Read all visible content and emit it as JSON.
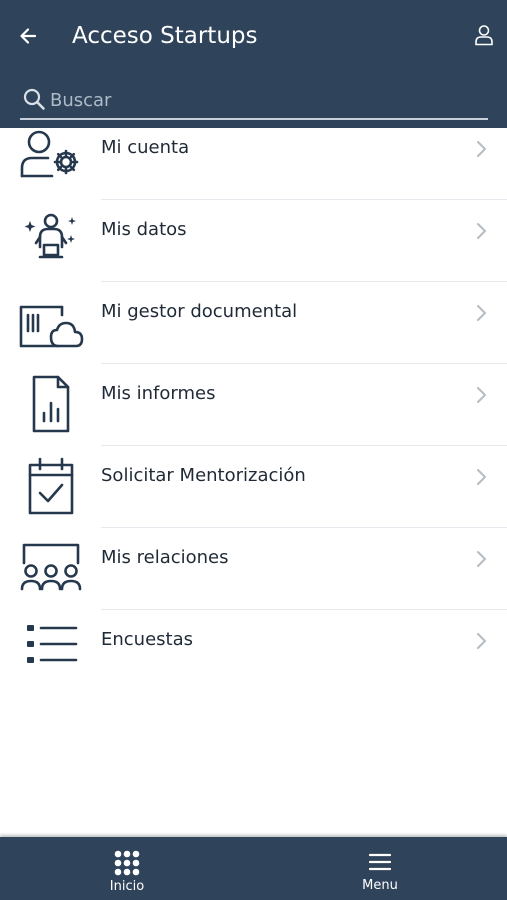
{
  "header": {
    "title": "Acceso Startups",
    "back_icon": "arrow-left-icon",
    "user_icon": "user-icon",
    "background": "#2f435a"
  },
  "search": {
    "placeholder": "Buscar",
    "value": "",
    "icon": "search-icon"
  },
  "menu": {
    "items": [
      {
        "label": "Mi cuenta",
        "icon": "user-settings-icon"
      },
      {
        "label": "Mis datos",
        "icon": "person-data-icon"
      },
      {
        "label": "Mi gestor documental",
        "icon": "document-cloud-icon"
      },
      {
        "label": "Mis informes",
        "icon": "report-icon"
      },
      {
        "label": "Solicitar Mentorización",
        "icon": "calendar-check-icon"
      },
      {
        "label": "Mis relaciones",
        "icon": "group-icon"
      },
      {
        "label": "Encuestas",
        "icon": "survey-list-icon"
      }
    ]
  },
  "bottom_nav": {
    "tabs": [
      {
        "label": "Inicio",
        "icon": "grid-icon"
      },
      {
        "label": "Menu",
        "icon": "hamburger-icon"
      }
    ]
  },
  "colors": {
    "accent": "#2f435a",
    "icon_stroke": "#26384d",
    "text": "#1f2a36",
    "chevron": "#b5bcc4"
  }
}
